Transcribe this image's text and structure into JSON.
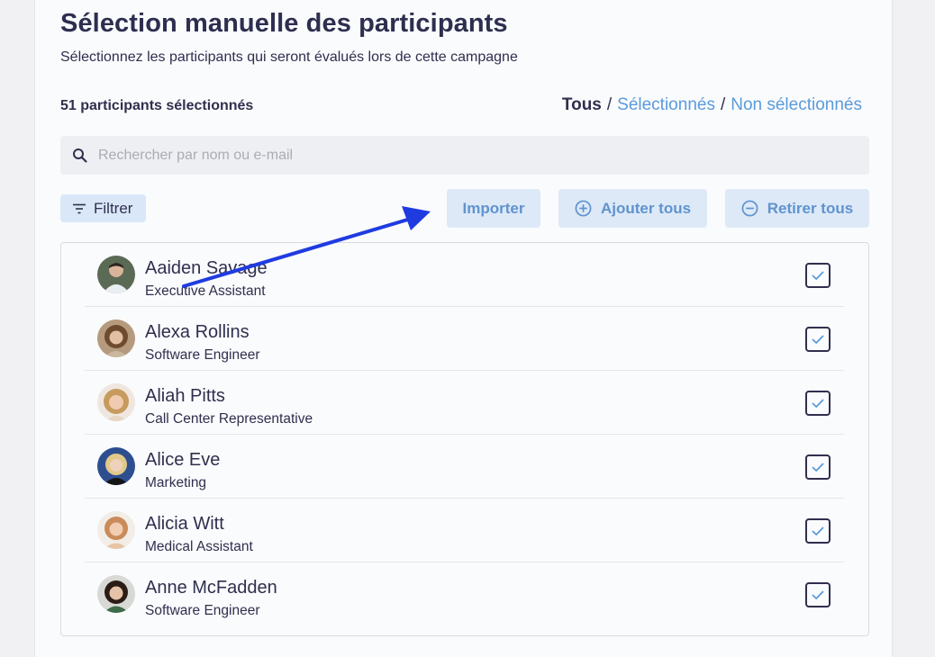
{
  "page": {
    "title": "Sélection manuelle des participants",
    "subtitle": "Sélectionnez les participants qui seront évalués lors de cette campagne",
    "count_label": "51 participants sélectionnés"
  },
  "view_filters": {
    "all": "Tous",
    "selected": "Sélectionnés",
    "unselected": "Non sélectionnés",
    "separator": "/"
  },
  "search": {
    "placeholder": "Rechercher par nom ou e-mail",
    "value": "",
    "icon": "search-icon"
  },
  "toolbar": {
    "filter_label": "Filtrer",
    "import_label": "Importer",
    "add_all_label": "Ajouter tous",
    "remove_all_label": "Retirer tous"
  },
  "participants": [
    {
      "name": "Aaiden Savage",
      "role": "Executive Assistant",
      "checked": true
    },
    {
      "name": "Alexa Rollins",
      "role": "Software Engineer",
      "checked": true
    },
    {
      "name": "Aliah Pitts",
      "role": "Call Center Representative",
      "checked": true
    },
    {
      "name": "Alice Eve",
      "role": "Marketing",
      "checked": true
    },
    {
      "name": "Alicia Witt",
      "role": "Medical Assistant",
      "checked": true
    },
    {
      "name": "Anne McFadden",
      "role": "Software Engineer",
      "checked": true
    }
  ],
  "colors": {
    "accent": "#5a9bdb",
    "button_bg": "#dde9f7",
    "annotation_arrow": "#1f3be0"
  }
}
